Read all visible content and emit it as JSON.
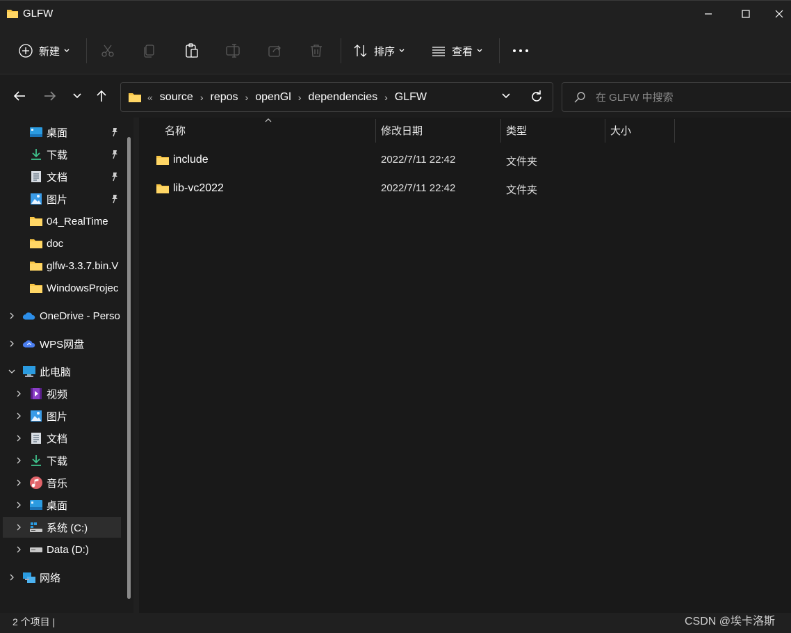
{
  "window": {
    "title": "GLFW",
    "controls": [
      "minimize-icon",
      "maximize-icon",
      "close-icon"
    ]
  },
  "toolbar": {
    "new_label": "新建",
    "sort_label": "排序",
    "view_label": "查看",
    "icons": [
      "plus-circle-icon",
      "cut-icon",
      "copy-icon",
      "paste-icon",
      "rename-icon",
      "share-icon",
      "delete-icon",
      "sort-icon",
      "view-icon",
      "more-icon"
    ]
  },
  "nav": {
    "breadcrumbs": [
      "source",
      "repos",
      "openGl",
      "dependencies",
      "GLFW"
    ],
    "lead": "«"
  },
  "search": {
    "placeholder": "在 GLFW 中搜索"
  },
  "sidebar": {
    "quick_access": [
      {
        "label": "桌面",
        "icon": "desktop-icon",
        "pinned": true
      },
      {
        "label": "下载",
        "icon": "download-icon",
        "pinned": true
      },
      {
        "label": "文档",
        "icon": "document-icon",
        "pinned": true
      },
      {
        "label": "图片",
        "icon": "pictures-icon",
        "pinned": true
      },
      {
        "label": "04_RealTime",
        "icon": "folder-icon",
        "pinned": false
      },
      {
        "label": "doc",
        "icon": "folder-icon",
        "pinned": false
      },
      {
        "label": "glfw-3.3.7.bin.V",
        "icon": "folder-icon",
        "pinned": false
      },
      {
        "label": "WindowsProjec",
        "icon": "folder-icon",
        "pinned": false
      }
    ],
    "onedrive": "OneDrive - Perso",
    "wps": "WPS网盘",
    "this_pc": "此电脑",
    "pc_items": [
      {
        "label": "视频",
        "icon": "video-icon"
      },
      {
        "label": "图片",
        "icon": "pictures-icon"
      },
      {
        "label": "文档",
        "icon": "document-icon"
      },
      {
        "label": "下载",
        "icon": "download-icon"
      },
      {
        "label": "音乐",
        "icon": "music-icon"
      },
      {
        "label": "桌面",
        "icon": "desktop-icon"
      },
      {
        "label": "系统 (C:)",
        "icon": "system-drive-icon",
        "selected": true
      },
      {
        "label": "Data (D:)",
        "icon": "drive-icon"
      }
    ],
    "network": "网络"
  },
  "columns": {
    "name": "名称",
    "modified": "修改日期",
    "type": "类型",
    "size": "大小"
  },
  "files": [
    {
      "name": "include",
      "modified": "2022/7/11 22:42",
      "type": "文件夹",
      "size": ""
    },
    {
      "name": "lib-vc2022",
      "modified": "2022/7/11 22:42",
      "type": "文件夹",
      "size": ""
    }
  ],
  "status": {
    "item_count": "2 个项目  |"
  },
  "watermark": "CSDN @埃卡洛斯",
  "colors": {
    "folder": "#f8c545",
    "accent": "#4cc2ff",
    "background": "#191919"
  }
}
